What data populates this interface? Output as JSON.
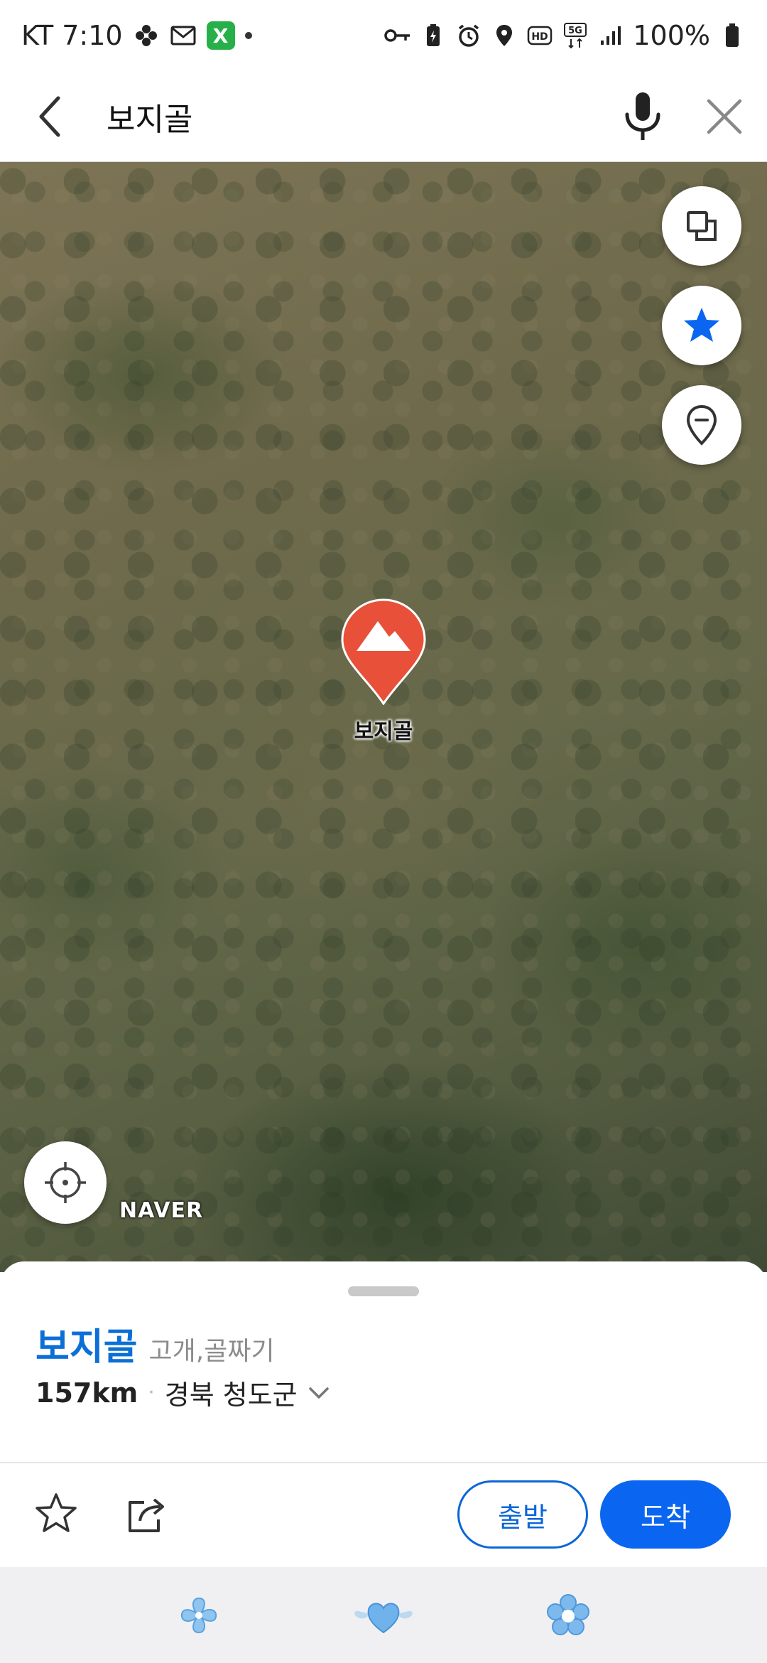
{
  "status_bar": {
    "carrier_time": "KT 7:10",
    "app_badge_letter": "X",
    "battery": "100%"
  },
  "header": {
    "search_query": "보지골"
  },
  "map": {
    "marker_label": "보지골",
    "provider_logo": "NAVER",
    "marker_color": "#e8503a"
  },
  "place": {
    "name": "보지골",
    "category": "고개,골짜기",
    "distance": "157km",
    "address": "경북 청도군"
  },
  "actions": {
    "depart_label": "출발",
    "arrive_label": "도착"
  },
  "colors": {
    "accent": "#0a66f0",
    "place_name": "#0c6fd6"
  },
  "icons": [
    "back-arrow-icon",
    "mic-icon",
    "close-icon",
    "layers-icon",
    "star-icon",
    "pin-icon",
    "locate-icon",
    "star-outline-icon",
    "share-icon",
    "chevron-down-icon"
  ]
}
